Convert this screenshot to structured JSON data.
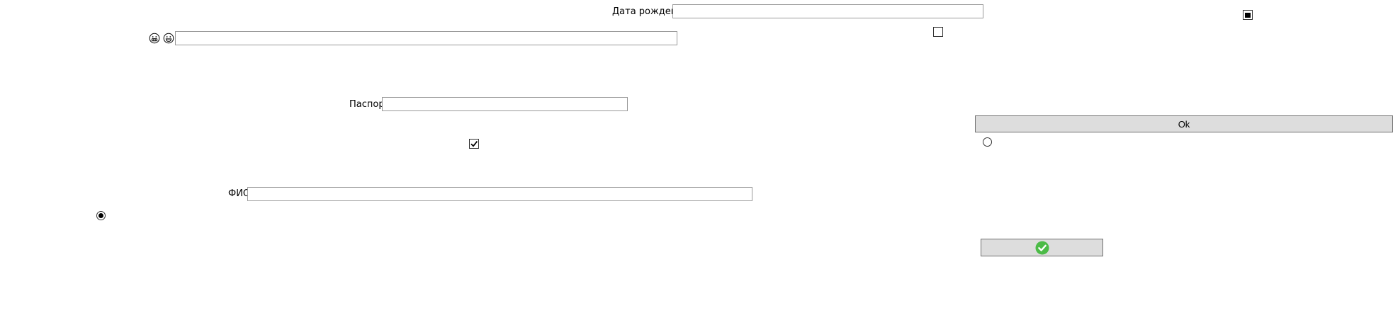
{
  "form": {
    "birth_date": {
      "label": "Дата рождения",
      "value": ""
    },
    "emoji_field": {
      "value": ""
    },
    "passport": {
      "label": "Паспорт",
      "value": ""
    },
    "full_name": {
      "label": "ФИО",
      "value": ""
    },
    "ok_button_label": "Ok",
    "checkbox_top": {
      "checked": false
    },
    "checkbox_middle": {
      "checked": true
    },
    "checkbox_filled": {
      "checked": true
    },
    "radio_right": {
      "selected": false
    },
    "radio_left": {
      "selected": true
    }
  },
  "icons": {
    "emoji_1": "grimacing-face-icon",
    "emoji_2": "grinning-face-icon",
    "confirm": "green-checkmark-icon"
  },
  "colors": {
    "button_bg": "#dddddd",
    "confirm_green": "#4cbb47"
  }
}
